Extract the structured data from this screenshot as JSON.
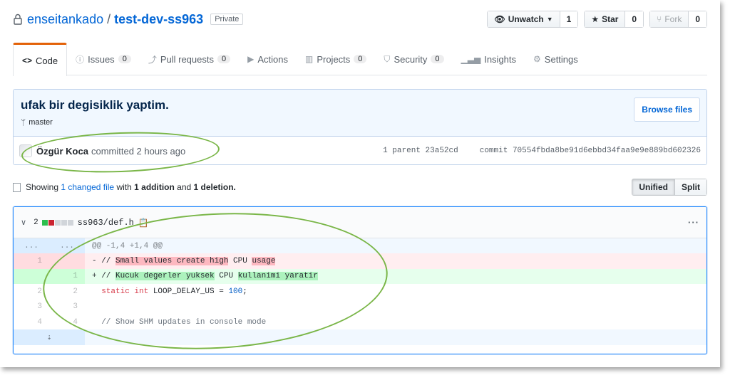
{
  "repo": {
    "owner": "enseitankado",
    "separator": "/",
    "name": "test-dev-ss963",
    "visibility": "Private",
    "watch": {
      "label": "Unwatch",
      "count": "1"
    },
    "star": {
      "label": "Star",
      "count": "0"
    },
    "fork": {
      "label": "Fork",
      "count": "0"
    }
  },
  "tabs": [
    {
      "label": "Code",
      "counter": null
    },
    {
      "label": "Issues",
      "counter": "0"
    },
    {
      "label": "Pull requests",
      "counter": "0"
    },
    {
      "label": "Actions",
      "counter": null
    },
    {
      "label": "Projects",
      "counter": "0"
    },
    {
      "label": "Security",
      "counter": "0"
    },
    {
      "label": "Insights",
      "counter": null
    },
    {
      "label": "Settings",
      "counter": null
    }
  ],
  "commit": {
    "title": "ufak bir degisiklik yaptim.",
    "branch": "master",
    "browse_label": "Browse files",
    "author": "Özgür Koca",
    "committed_text": "committed 2 hours ago",
    "parent_text": "1 parent 23a52cd",
    "sha_text": "commit 70554fbda8be91d6ebbd34faa9e9e889bd602326"
  },
  "toc": {
    "showing": "Showing",
    "changed": "1 changed file",
    "with": "with",
    "additions": "1 addition",
    "and": "and",
    "deletions": "1 deletion."
  },
  "view": {
    "unified": "Unified",
    "split": "Split"
  },
  "file": {
    "changes": "2",
    "path": "ss963/def.h",
    "more": "···",
    "hunk_left": "...",
    "hunk_right": "...",
    "hunk_header": "@@ -1,4 +1,4 @@",
    "del_line": {
      "old": "1",
      "prefix": "- // ",
      "hl1": "Small values create high",
      "mid": " CPU ",
      "hl2": "usage"
    },
    "add_line": {
      "new": "1",
      "prefix": "+ // ",
      "hl1": "Kucuk degerler yuksek",
      "mid": " CPU ",
      "hl2": "kullanimi yaratir"
    },
    "ctx1": {
      "old": "2",
      "new": "2",
      "kw": "static int",
      "name": " LOOP_DELAY_US = ",
      "num": "100",
      "end": ";"
    },
    "ctx2": {
      "old": "3",
      "new": "3",
      "text": ""
    },
    "ctx3": {
      "old": "4",
      "new": "4",
      "text": "  // Show SHM updates in console mode"
    }
  },
  "colors": {
    "accent": "#0366d6",
    "tab_active": "#e36209",
    "annotation": "#7ab648"
  }
}
